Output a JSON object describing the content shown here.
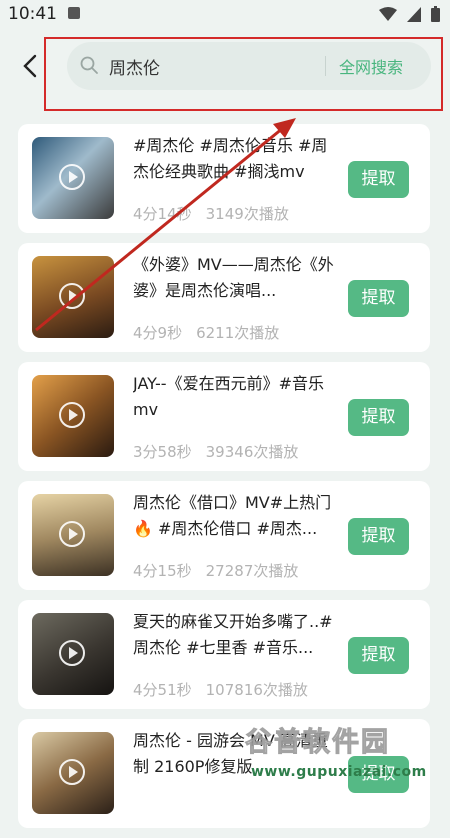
{
  "status": {
    "time": "10:41"
  },
  "search": {
    "value": "周杰伦",
    "placeholder": "",
    "web_search_label": "全网搜索"
  },
  "items": [
    {
      "title": "#周杰伦 #周杰伦音乐 #周杰伦经典歌曲 #搁浅mv",
      "duration": "4分14秒",
      "plays": "3149次播放",
      "button": "提取"
    },
    {
      "title": "《外婆》MV——周杰伦《外婆》是周杰伦演唱...",
      "duration": "4分9秒",
      "plays": "6211次播放",
      "button": "提取"
    },
    {
      "title": "JAY--《爱在西元前》#音乐mv",
      "duration": "3分58秒",
      "plays": "39346次播放",
      "button": "提取"
    },
    {
      "title": "周杰伦《借口》MV#上热门🔥 #周杰伦借口 #周杰...",
      "duration": "4分15秒",
      "plays": "27287次播放",
      "button": "提取"
    },
    {
      "title": "夏天的麻雀又开始多嘴了..#周杰伦 #七里香 #音乐...",
      "duration": "4分51秒",
      "plays": "107816次播放",
      "button": "提取"
    },
    {
      "title": "周杰伦 - 园游会 MV 高清重制 2160P修复版",
      "duration": "",
      "plays": "",
      "button": "提取"
    }
  ],
  "watermark": {
    "brand": "谷普软件园",
    "url": "www.gupuxiazai.com"
  },
  "colors": {
    "accent": "#55b985",
    "annotation": "#d42a2a"
  }
}
